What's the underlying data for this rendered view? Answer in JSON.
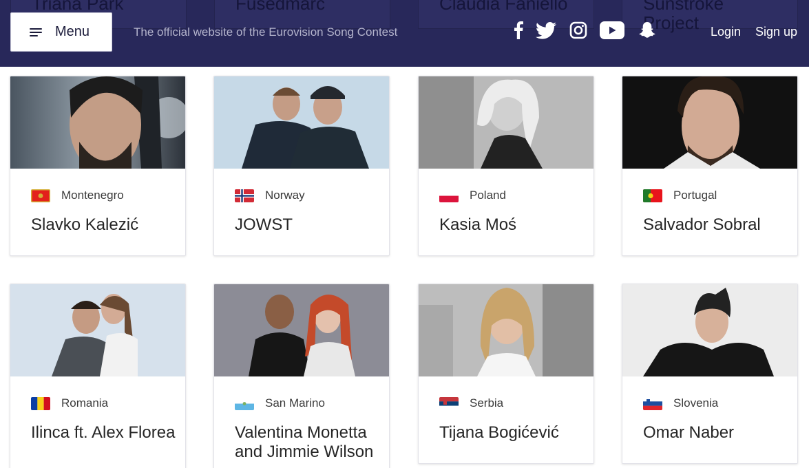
{
  "header": {
    "menu_label": "Menu",
    "tagline": "The official website of the Eurovision Song Contest",
    "login": "Login",
    "signup": "Sign up",
    "behind_cards": [
      "Triana Park",
      "Fusedmarc",
      "Claudia Faniello",
      "Sunstroke Project"
    ],
    "social_icons": [
      "facebook-icon",
      "twitter-icon",
      "instagram-icon",
      "youtube-icon",
      "snapchat-icon"
    ]
  },
  "artists": [
    {
      "country": "Montenegro",
      "name": "Slavko Kalezić",
      "flag": "montenegro"
    },
    {
      "country": "Norway",
      "name": "JOWST",
      "flag": "norway"
    },
    {
      "country": "Poland",
      "name": "Kasia Moś",
      "flag": "poland"
    },
    {
      "country": "Portugal",
      "name": "Salvador Sobral",
      "flag": "portugal"
    },
    {
      "country": "Romania",
      "name": "Ilinca ft. Alex Florea",
      "flag": "romania"
    },
    {
      "country": "San Marino",
      "name": "Valentina Monetta and Jimmie Wilson",
      "flag": "san-marino"
    },
    {
      "country": "Serbia",
      "name": "Tijana Bogićević",
      "flag": "serbia"
    },
    {
      "country": "Slovenia",
      "name": "Omar Naber",
      "flag": "slovenia"
    }
  ],
  "colors": {
    "header_bg": "#28285a",
    "card_border": "#e2e2e8"
  }
}
